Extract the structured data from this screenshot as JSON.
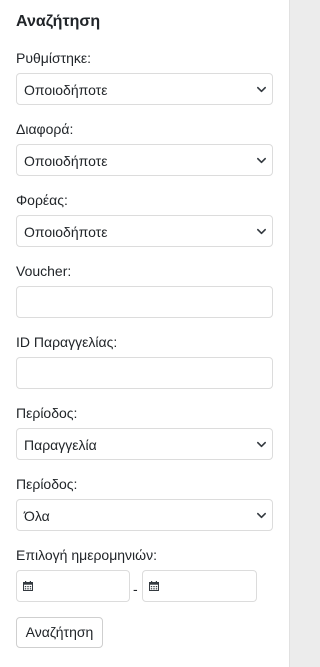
{
  "search": {
    "title": "Αναζήτηση",
    "fields": {
      "adjusted": {
        "label": "Ρυθμίστηκε:",
        "value": "Οποιοδήποτε"
      },
      "difference": {
        "label": "Διαφορά:",
        "value": "Οποιοδήποτε"
      },
      "carrier": {
        "label": "Φορέας:",
        "value": "Οποιοδήποτε"
      },
      "voucher": {
        "label": "Voucher:",
        "value": ""
      },
      "order_id": {
        "label": "ID Παραγγελίας:",
        "value": ""
      },
      "period_type": {
        "label": "Περίοδος:",
        "value": "Παραγγελία"
      },
      "period_range": {
        "label": "Περίοδος:",
        "value": "Όλα"
      },
      "date_range": {
        "label": "Επιλογή ημερομηνιών:",
        "separator": "-",
        "from": "",
        "to": ""
      }
    },
    "submit_label": "Αναζήτηση"
  },
  "icons": {
    "select_arrow": "chevron-down-icon",
    "date_picker": "calendar-icon"
  },
  "colors": {
    "panel_background": "#ffffff",
    "page_background": "#ececec",
    "text": "#212529",
    "border": "#dcdcdc"
  }
}
